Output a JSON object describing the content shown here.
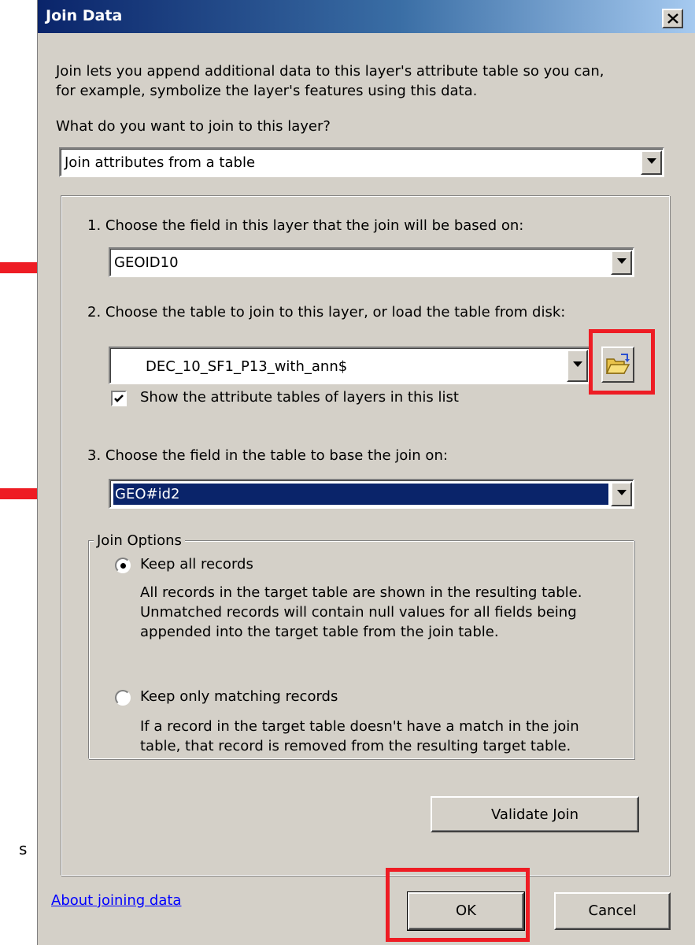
{
  "window": {
    "title": "Join Data"
  },
  "intro_text": "Join lets you append additional data to this layer's attribute table so you can,\nfor example, symbolize the layer's features using this data.",
  "join_question": "What do you want to join to this layer?",
  "join_type": {
    "value": "Join attributes from a table"
  },
  "step1": {
    "label": "1.  Choose the field in this layer that the join will be based on:",
    "value": "GEOID10"
  },
  "step2": {
    "label": "2.  Choose the table to join to this layer, or load the table from disk:",
    "value": "DEC_10_SF1_P13_with_ann$",
    "show_attr_label": "Show the attribute tables of layers in this list",
    "show_attr_checked": true
  },
  "step3": {
    "label": "3.  Choose the field in the table to base the join on:",
    "value": "GEO#id2"
  },
  "join_options": {
    "legend": "Join Options",
    "keep_all_label": "Keep all records",
    "keep_all_desc": "All records in the target table are shown in the resulting table.\nUnmatched records will contain null values for all fields being\nappended into the target table from the join table.",
    "keep_matching_label": "Keep only matching records",
    "keep_matching_desc": "If a record in the target table doesn't have a match in the join\ntable, that record is removed from the resulting target table.",
    "selected": "keep_all"
  },
  "validate_label": "Validate Join",
  "about_link": "About joining data",
  "ok_label": "OK",
  "cancel_label": "Cancel",
  "edge_fragment": "s",
  "colors": {
    "annotation_red": "#ee1c24",
    "title_bar": "#0a246a",
    "selection": "#0a246a",
    "dialog_bg": "#d4d0c8"
  },
  "icons": [
    "close-icon",
    "dropdown-arrow-icon",
    "folder-open-icon",
    "checkmark-icon",
    "annotation-arrow"
  ]
}
